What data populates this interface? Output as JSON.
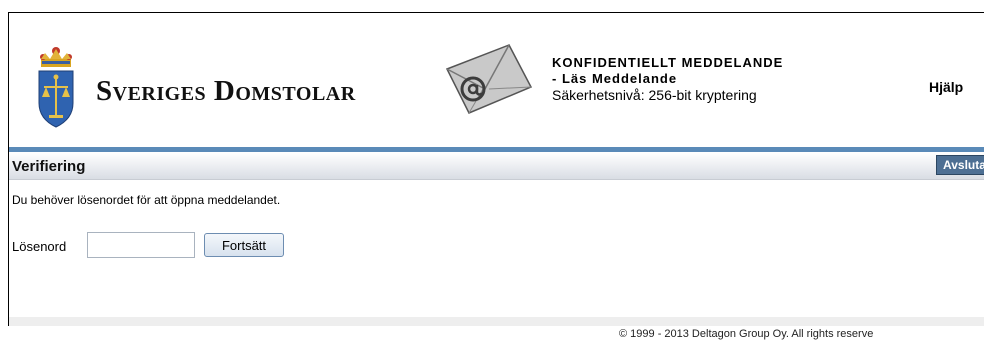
{
  "header": {
    "logo_text": "Sveriges Domstolar",
    "envelope_icon": "envelope-at-icon",
    "message_title": "KONFIDENTIELLT MEDDELANDE",
    "message_subtitle": "- Läs Meddelande",
    "security_level": "Säkerhetsnivå: 256-bit kryptering",
    "help_label": "Hjälp"
  },
  "section": {
    "title": "Verifiering",
    "exit_label": "Avsluta"
  },
  "form": {
    "instruction": "Du behöver lösenordet för att öppna meddelandet.",
    "password_label": "Lösenord",
    "password_value": "",
    "continue_label": "Fortsätt"
  },
  "footer": {
    "copyright": "© 1999 - 2013 Deltagon Group Oy. All rights reserve"
  },
  "colors": {
    "accent_blue": "#5a8ab8",
    "button_dark": "#4d6f93"
  }
}
